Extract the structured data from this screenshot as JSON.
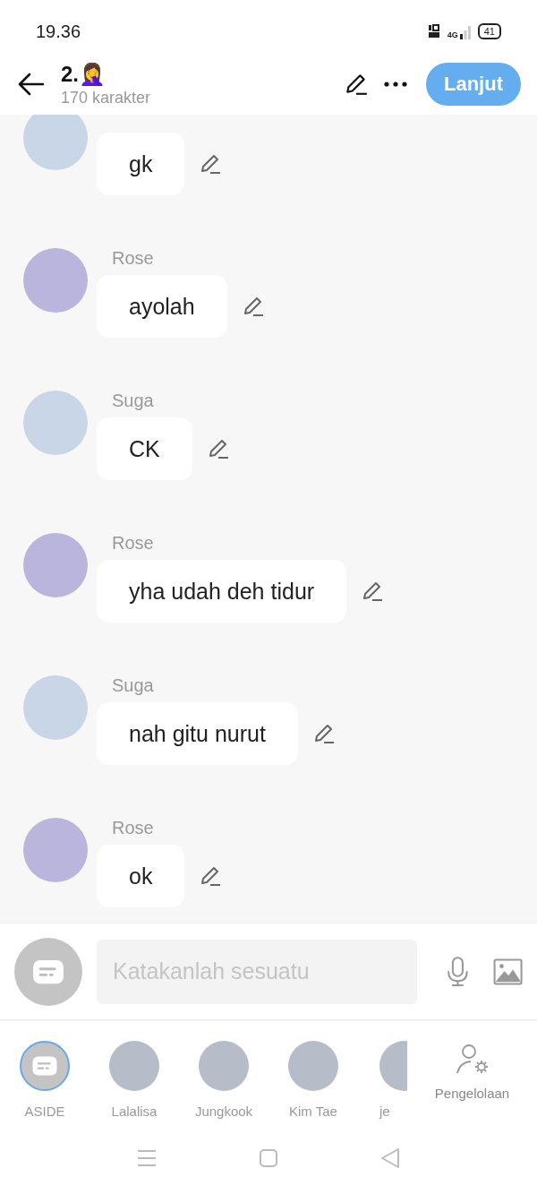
{
  "status_bar": {
    "time": "19.36",
    "network": "4G",
    "battery": "41"
  },
  "header": {
    "title": "2.🤦‍♀️",
    "subtitle": "170 karakter",
    "next_button": "Lanjut"
  },
  "messages": [
    {
      "text": "gk"
    },
    {
      "name": "Rose",
      "text": "ayolah"
    },
    {
      "name": "Suga",
      "text": "CK"
    },
    {
      "name": "Rose",
      "text": "yha udah deh tidur"
    },
    {
      "name": "Suga",
      "text": "nah gitu nurut"
    },
    {
      "name": "Rose",
      "text": "ok"
    }
  ],
  "composer": {
    "placeholder": "Katakanlah sesuatu"
  },
  "characters": [
    {
      "name": "ASIDE",
      "kind": "narrator",
      "selected": true
    },
    {
      "name": "Lalalisa",
      "kind": "avatar",
      "selected": false
    },
    {
      "name": "Jungkook",
      "kind": "avatar",
      "selected": false
    },
    {
      "name": "Kim Tae",
      "kind": "avatar",
      "selected": false
    },
    {
      "name": "je",
      "kind": "avatar",
      "selected": false
    }
  ],
  "manage_button": "Pengelolaan"
}
